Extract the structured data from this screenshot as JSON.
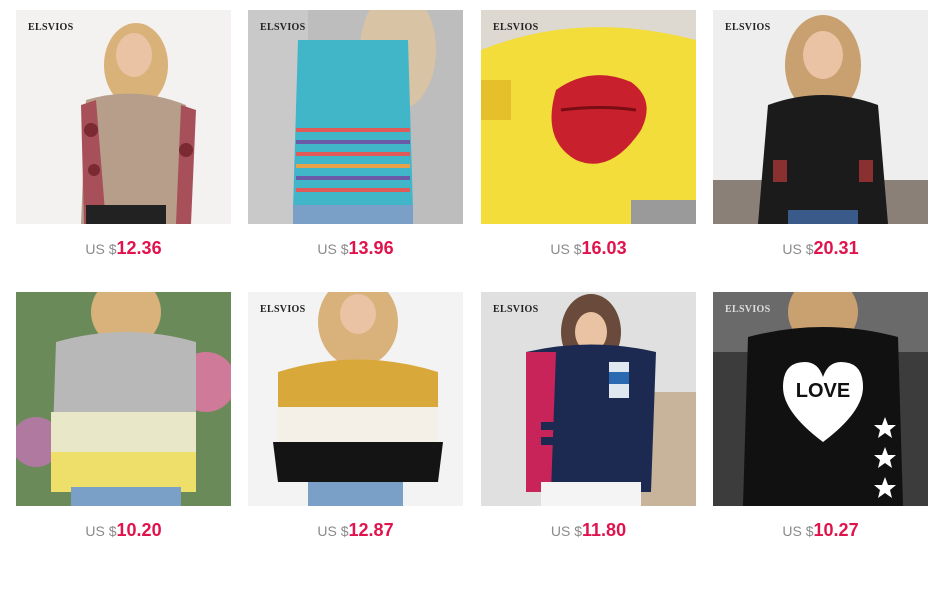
{
  "products": [
    {
      "brand": "ELSVIOS",
      "currency": "US $",
      "price": "12.36",
      "image": "woman-hoodie-floral-sleeves"
    },
    {
      "brand": "ELSVIOS",
      "currency": "US $",
      "price": "13.96",
      "image": "woman-striped-tank-top"
    },
    {
      "brand": "ELSVIOS",
      "currency": "US $",
      "price": "16.03",
      "image": "yellow-top-lips-print"
    },
    {
      "brand": "ELSVIOS",
      "currency": "US $",
      "price": "20.31",
      "image": "black-turtleneck-sweatshirt"
    },
    {
      "brand": "",
      "currency": "US $",
      "price": "10.20",
      "image": "tie-dye-sweatshirt"
    },
    {
      "brand": "ELSVIOS",
      "currency": "US $",
      "price": "12.87",
      "image": "colorblock-fleece-pullover"
    },
    {
      "brand": "ELSVIOS",
      "currency": "US $",
      "price": "11.80",
      "image": "navy-colorblock-hoodie"
    },
    {
      "brand": "ELSVIOS",
      "currency": "US $",
      "price": "10.27",
      "image": "black-love-heart-sweatshirt"
    }
  ],
  "colors": {
    "price": "#e0134c",
    "currency": "#8a8a8a"
  }
}
